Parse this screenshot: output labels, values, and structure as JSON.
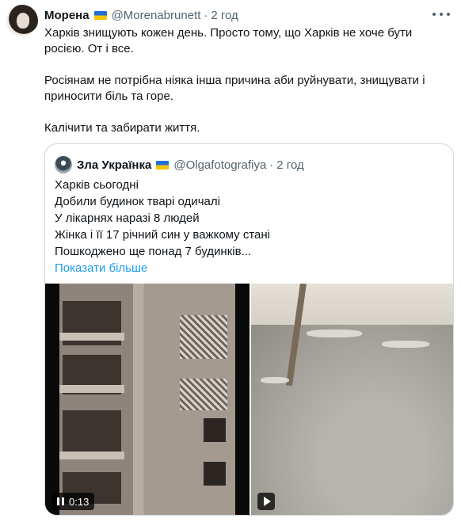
{
  "tweet": {
    "author_name": "Морена",
    "author_handle": "@Morenabrunett",
    "time": "2 год",
    "text_lines": [
      "Харків знищують кожен день. Просто тому, що Харків не хоче бути росією. От і все.",
      "Росіянам не потрібна ніяка інша причина аби руйнувати, знищувати і приносити біль та горе.",
      "Калічити та забирати життя."
    ],
    "icons": {
      "more": "more-icon",
      "flag": "ukraine-flag-icon"
    }
  },
  "quote": {
    "author_name": "Зла Українка",
    "author_handle": "@Olgafotografiya",
    "time": "2 год",
    "lines": [
      "Харків сьогодні",
      "Добили будинок тварі одичалі",
      "У лікарнях наразі 8 людей",
      "Жінка і її 17 річний син у важкому стані",
      "Пошкоджено ще понад 7 будинків..."
    ],
    "show_more": "Показати більше",
    "media": {
      "left_video": {
        "duration": "0:13",
        "control": "pause-icon"
      },
      "right_video": {
        "control": "play-icon"
      }
    }
  },
  "colors": {
    "accent": "#1d9bf0",
    "muted": "#536471",
    "border": "#cfd9de"
  }
}
